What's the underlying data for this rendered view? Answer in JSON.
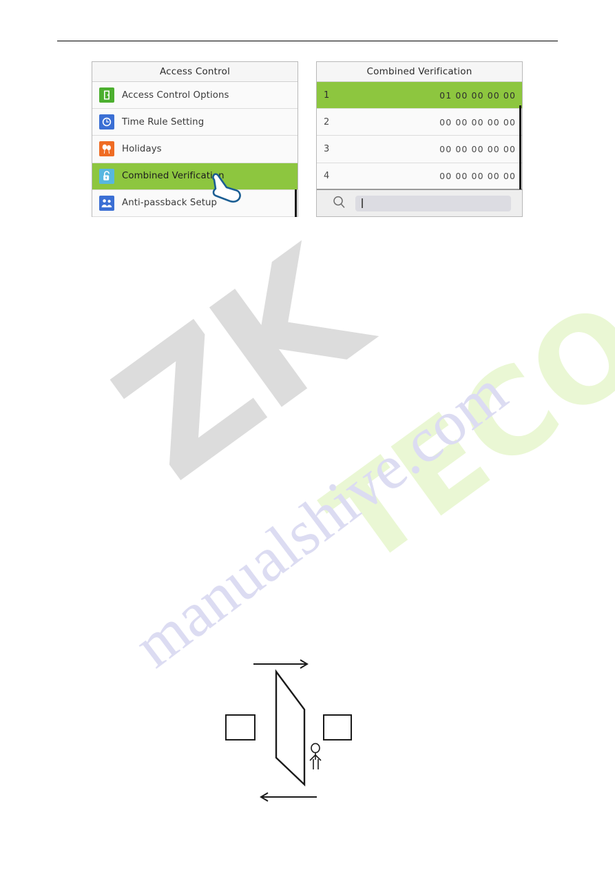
{
  "page": {
    "header_rule": true,
    "watermark": {
      "brand_mark": "ZK",
      "brand_word": "TECO",
      "site": "manualshive.com"
    },
    "colors": {
      "selection_green": "#8dc63f",
      "icon_green": "#4caf2f",
      "icon_blue": "#3b6fd4",
      "icon_orange": "#ef6c24",
      "icon_lightblue": "#57b7e0",
      "panel_bg": "#fafafa",
      "title_bg": "#f6f6f6",
      "search_bg": "#eeeeee",
      "search_field": "#dcdce2",
      "cursor_outline": "#1b5e93"
    }
  },
  "left_panel": {
    "title": "Access Control",
    "items": [
      {
        "label": "Access Control Options",
        "icon": "door-icon",
        "selected": false
      },
      {
        "label": "Time Rule Setting",
        "icon": "clock-icon",
        "selected": false
      },
      {
        "label": "Holidays",
        "icon": "balloons-icon",
        "selected": false
      },
      {
        "label": "Combined Verification",
        "icon": "unlocked-lock-icon",
        "selected": true
      },
      {
        "label": "Anti-passback Setup",
        "icon": "two-people-icon",
        "selected": false
      }
    ],
    "cursor": "hand-pointer-cursor"
  },
  "right_panel": {
    "title": "Combined Verification",
    "columns": [
      "index",
      "value"
    ],
    "rows": [
      {
        "index": "1",
        "value": "01 00 00 00 00",
        "selected": true
      },
      {
        "index": "2",
        "value": "00 00 00 00 00",
        "selected": false
      },
      {
        "index": "3",
        "value": "00 00 00 00 00",
        "selected": false
      },
      {
        "index": "4",
        "value": "00 00 00 00 00",
        "selected": false
      }
    ],
    "search": {
      "icon": "magnifier-icon",
      "value": "",
      "placeholder": ""
    }
  },
  "diagram": {
    "name": "anti-passback-door-diagram",
    "elements": {
      "top_arrow": "arrow-right",
      "bottom_arrow": "arrow-left",
      "door": "door-parallelogram",
      "left_box": "reader-box-left",
      "right_box": "reader-box-right",
      "person": "stick-figure-person"
    }
  }
}
